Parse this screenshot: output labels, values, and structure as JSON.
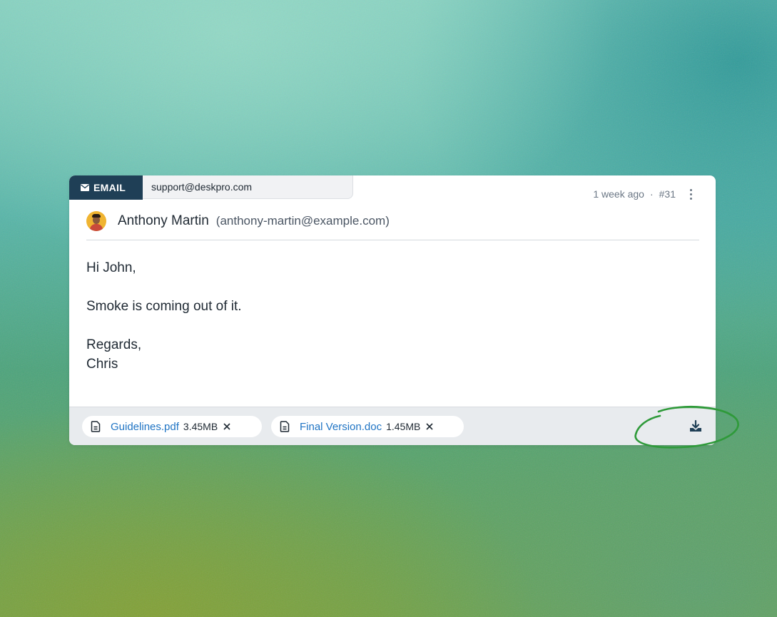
{
  "tabs": {
    "channel_label": "EMAIL",
    "mailbox": "support@deskpro.com"
  },
  "meta": {
    "time": "1 week ago",
    "separator": "·",
    "number": "#31"
  },
  "sender": {
    "name": "Anthony Martin",
    "email": "(anthony-martin@example.com)"
  },
  "message": {
    "greeting": "Hi John,",
    "body": "Smoke is coming out of it.",
    "signoff": "Regards,",
    "signature": "Chris"
  },
  "attachments": [
    {
      "name": "Guidelines.pdf",
      "size": "3.45MB"
    },
    {
      "name": "Final Version.doc",
      "size": "1.45MB"
    }
  ],
  "icons": {
    "channel": "mail-icon",
    "more": "more-vertical-icon",
    "file": "file-icon",
    "remove": "close-icon",
    "download": "download-icon"
  },
  "colors": {
    "channel_tab": "#1f3f56",
    "link": "#1f74c4",
    "highlight_ring": "#2f9a3a"
  }
}
